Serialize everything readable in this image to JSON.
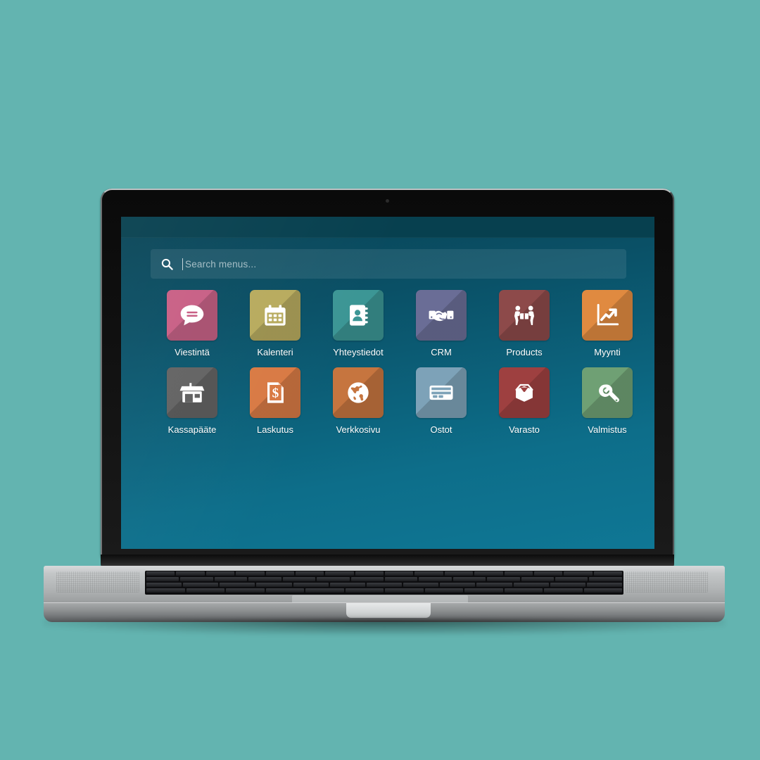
{
  "background_color": "#63b4b0",
  "device": {
    "type": "laptop",
    "body_color": "#b0b3b4",
    "bezel_color": "#0f0f0f"
  },
  "screen": {
    "background_gradient": [
      "#084355",
      "#0f7795"
    ],
    "topbar_color": "#07404f",
    "search": {
      "icon": "search-icon",
      "placeholder": "Search menus...",
      "value": "",
      "has_caret": true
    },
    "apps": [
      {
        "label": "Viestintä",
        "icon": "chat-bubble-icon",
        "color": "#c85f85"
      },
      {
        "label": "Kalenteri",
        "icon": "calendar-icon",
        "color": "#b8ab5e"
      },
      {
        "label": "Yhteystiedot",
        "icon": "address-book-icon",
        "color": "#3c9695"
      },
      {
        "label": "CRM",
        "icon": "handshake-icon",
        "color": "#6a6d96"
      },
      {
        "label": "Products",
        "icon": "movers-box-icon",
        "color": "#8d4a4a"
      },
      {
        "label": "Myynti",
        "icon": "trend-chart-icon",
        "color": "#e08a40"
      },
      {
        "label": "Kassapääte",
        "icon": "storefront-icon",
        "color": "#636363"
      },
      {
        "label": "Laskutus",
        "icon": "invoice-dollar-icon",
        "color": "#d97a44"
      },
      {
        "label": "Verkkosivu",
        "icon": "globe-icon",
        "color": "#c6753f"
      },
      {
        "label": "Ostot",
        "icon": "credit-card-icon",
        "color": "#7da2b8"
      },
      {
        "label": "Varasto",
        "icon": "open-box-icon",
        "color": "#9e4040"
      },
      {
        "label": "Valmistus",
        "icon": "wrench-icon",
        "color": "#6fa074"
      }
    ]
  }
}
